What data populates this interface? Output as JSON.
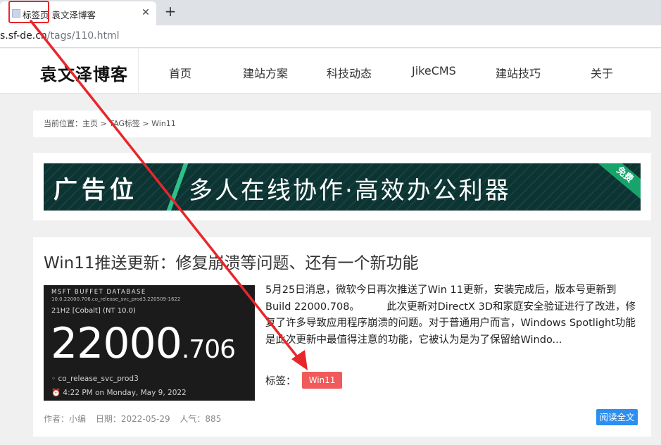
{
  "browser": {
    "tab_favicon": "page-icon",
    "tab_title": "标签页 袁文泽博客",
    "tab_close": "✕",
    "new_tab": "+",
    "url_host": "s.sf-de.cn",
    "url_path": "/tags/110.html"
  },
  "site": {
    "logo": "袁文泽博客",
    "nav": [
      "首页",
      "建站方案",
      "科技动态",
      "JikeCMS",
      "建站技巧",
      "关于"
    ]
  },
  "breadcrumb": "当前位置：主页 > TAG标签 > Win11",
  "ad": {
    "label": "广告位",
    "slogan": "多人在线协作·高效办公利器",
    "ribbon": "免费"
  },
  "article": {
    "title": "Win11推送更新：修复崩溃等问题、还有一个新功能",
    "thumbnail": {
      "line1": "MSFT BUFFET DATABASE",
      "line2": "10.0.22000.706.co_release_svc_prod3.220509-1622",
      "line3": "21H2 [Cobalt] (NT 10.0)",
      "big_main": "22000",
      "big_minor": ".706",
      "line4": "co_release_svc_prod3",
      "line5": "4:22 PM on Monday, May 9, 2022"
    },
    "summary": "5月25日消息，微软今日再次推送了Win 11更新，安装完成后，版本号更新到 Build 22000.708。 　 　此次更新对DirectX 3D和家庭安全验证进行了改进，修复了许多导致应用程序崩溃的问题。对于普通用户而言，Windows Spotlight功能是此次更新中最值得注意的功能，它被认为是为了保留给Windo...",
    "tags_label": "标签：",
    "tag": "Win11",
    "author": "作者：小编",
    "date": "日期：2022-05-29",
    "views": "人气：885",
    "read_more": "阅读全文"
  },
  "colors": {
    "annotation": "#e8262b",
    "tag_bg": "#f05a5a",
    "button_bg": "#2c8ff0",
    "ad_bg": "#0b3433"
  }
}
